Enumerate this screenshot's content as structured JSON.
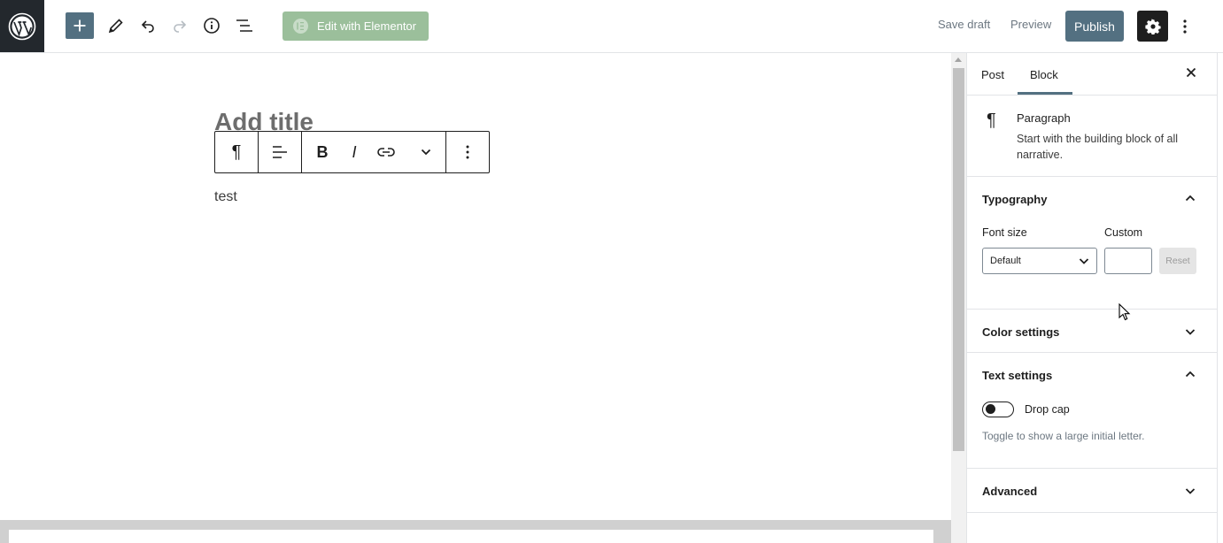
{
  "toolbar": {
    "elementor_label": "Edit with Elementor",
    "save_draft_label": "Save draft",
    "preview_label": "Preview",
    "publish_label": "Publish"
  },
  "editor": {
    "title_placeholder": "Add title",
    "paragraph_text": "test",
    "block_toolbar": {
      "paragraph_glyph": "¶",
      "bold_glyph": "B",
      "italic_glyph": "I"
    }
  },
  "sidebar": {
    "tabs": [
      {
        "label": "Post",
        "active": false
      },
      {
        "label": "Block",
        "active": true
      }
    ],
    "block_card": {
      "icon": "¶",
      "title": "Paragraph",
      "description": "Start with the building block of all narrative."
    },
    "typography": {
      "title": "Typography",
      "expanded": true,
      "font_size_label": "Font size",
      "font_size_value": "Default",
      "custom_label": "Custom",
      "custom_value": "",
      "reset_label": "Reset"
    },
    "color_settings": {
      "title": "Color settings",
      "expanded": false
    },
    "text_settings": {
      "title": "Text settings",
      "expanded": true,
      "drop_cap_label": "Drop cap",
      "drop_cap_enabled": false,
      "help": "Toggle to show a large initial letter."
    },
    "advanced": {
      "title": "Advanced",
      "expanded": false
    }
  },
  "colors": {
    "accent": "#537081",
    "wp_logo_bg": "#23282d",
    "elementor_green": "#9bbf9b"
  }
}
